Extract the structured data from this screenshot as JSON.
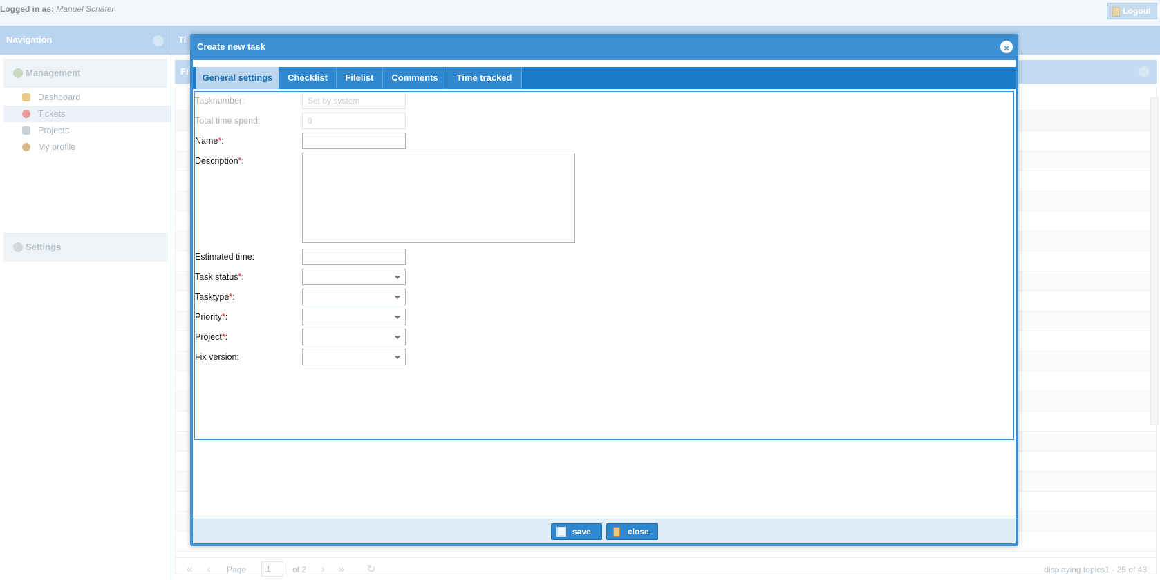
{
  "header": {
    "logged_in_label": "Logged in as:",
    "user_name": "Manuel Schäfer",
    "logout_label": "Logout"
  },
  "navigation": {
    "title": "Navigation",
    "management_label": "Management",
    "items": [
      {
        "label": "Dashboard",
        "icon": "dashboard-icon",
        "color": "#e8c98a"
      },
      {
        "label": "Tickets",
        "icon": "tickets-icon",
        "color": "#e79a9a"
      },
      {
        "label": "Projects",
        "icon": "projects-icon",
        "color": "#c9d1d8"
      },
      {
        "label": "My profile",
        "icon": "profile-icon",
        "color": "#d9b98a"
      }
    ],
    "settings_label": "Settings"
  },
  "main": {
    "title_fragment": "Ti",
    "filter_fragment": "Fi",
    "pager": {
      "page_label": "Page",
      "page_value": "1",
      "of_label": "of 2",
      "display_text": "displaying topics1 - 25 of 43"
    }
  },
  "modal": {
    "title": "Create new task",
    "tabs": [
      {
        "label": "General settings",
        "active": true
      },
      {
        "label": "Checklist",
        "active": false
      },
      {
        "label": "Filelist",
        "active": false
      },
      {
        "label": "Comments",
        "active": false
      },
      {
        "label": "Time tracked",
        "active": false
      }
    ],
    "form": {
      "tasknumber_label": "Tasknumber:",
      "tasknumber_placeholder": "Set by system",
      "total_time_label": "Total time spend:",
      "total_time_value": "0",
      "name_label": "Name",
      "description_label": "Description",
      "estimated_time_label": "Estimated time:",
      "task_status_label": "Task status",
      "tasktype_label": "Tasktype",
      "priority_label": "Priority",
      "project_label": "Project",
      "fix_version_label": "Fix version:",
      "required_mark": "*",
      "colon": ":"
    },
    "footer": {
      "save_label": "save",
      "close_label": "close"
    }
  },
  "colors": {
    "accent": "#3e8fd2",
    "tab_bar": "#1a7ccb",
    "active_tab": "#bcd6ef",
    "required": "#dd1111"
  }
}
